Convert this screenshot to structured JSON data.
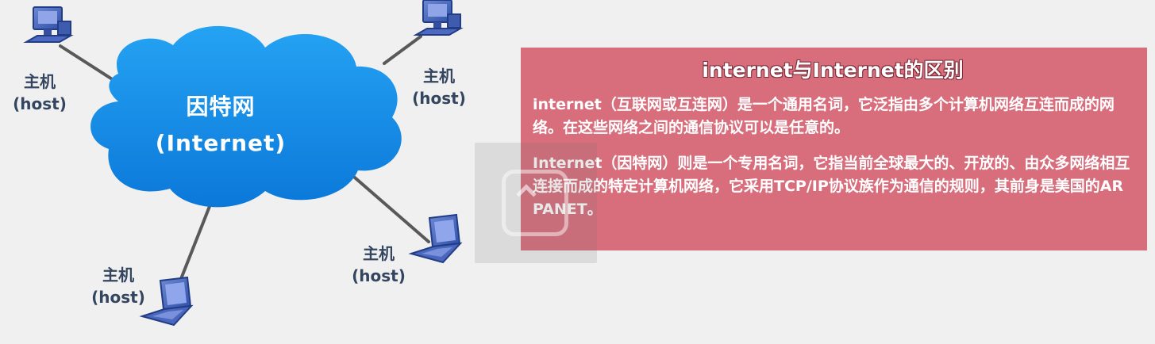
{
  "diagram": {
    "cloud": {
      "line1": "因特网",
      "line2": "(Internet)"
    },
    "hosts": [
      {
        "label": "主机",
        "sublabel": "(host)"
      },
      {
        "label": "主机",
        "sublabel": "(host)"
      },
      {
        "label": "主机",
        "sublabel": "(host)"
      },
      {
        "label": "主机",
        "sublabel": "(host)"
      }
    ]
  },
  "info": {
    "title": "internet与Internet的区别",
    "paragraphs": [
      "internet（互联网或互连网）是一个通用名词，它泛指由多个计算机网络互连而成的网络。在这些网络之间的通信协议可以是任意的。",
      "Internet（因特网）则是一个专用名词，它指当前全球最大的、开放的、由众多网络相互连接而成的特定计算机网络，它采用TCP/IP协议族作为通信的规则，其前身是美国的ARPANET。"
    ]
  },
  "colors": {
    "panel": "#d86e7c",
    "cloud": "#1690e8",
    "link": "#555555"
  },
  "icons": [
    "desktop-computer-icon",
    "laptop-computer-icon",
    "screen-overlay-icon"
  ]
}
